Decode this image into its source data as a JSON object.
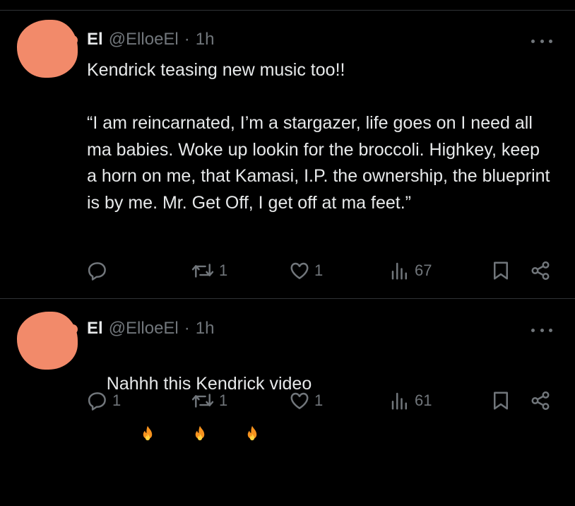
{
  "tweets": [
    {
      "author": {
        "display_name": "El",
        "handle": "@ElloeEl",
        "separator": "·",
        "time": "1h"
      },
      "text": "Kendrick teasing new music too!!\n\n“I am reincarnated, I’m a stargazer, life goes on I need all ma babies. Woke up lookin for the broccoli. Highkey, keep a horn on me, that Kamasi, I.P. the ownership, the blueprint is by me. Mr. Get Off, I get off at ma feet.”",
      "metrics": {
        "replies": "",
        "reposts": "1",
        "likes": "1",
        "views": "67"
      },
      "avatar_redacted": true,
      "avatar_color": "#f28a6a"
    },
    {
      "author": {
        "display_name": "El",
        "handle": "@ElloeEl",
        "separator": "·",
        "time": "1h"
      },
      "text": "Nahhh this Kendrick video",
      "emoji": [
        "fire",
        "fire",
        "fire"
      ],
      "metrics": {
        "replies": "1",
        "reposts": "1",
        "likes": "1",
        "views": "61"
      },
      "avatar_redacted": true,
      "avatar_color": "#f28a6a"
    }
  ],
  "colors": {
    "background": "#000000",
    "text": "#e7e9ea",
    "muted": "#71767b",
    "divider": "#2f3336"
  },
  "icons": [
    "more-icon",
    "reply-icon",
    "repost-icon",
    "like-icon",
    "views-icon",
    "bookmark-icon",
    "share-icon",
    "fire-emoji"
  ]
}
